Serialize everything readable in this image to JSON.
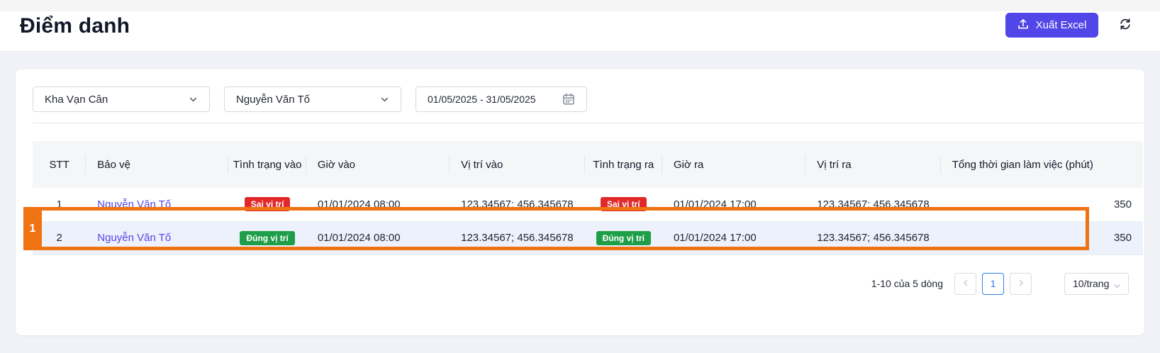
{
  "header": {
    "title": "Điểm danh",
    "export_label": "Xuất Excel",
    "export_icon": "upload-icon",
    "refresh_icon": "refresh-icon",
    "accent_color": "#5146e8"
  },
  "filters": {
    "location": "Kha Vạn Cân",
    "guard": "Nguyễn Văn Tố",
    "date_range": "01/05/2025 - 31/05/2025"
  },
  "table": {
    "columns": [
      "STT",
      "Bảo vệ",
      "Tình trạng vào",
      "Giờ vào",
      "Vị trí vào",
      "Tình trạng ra",
      "Giờ ra",
      "Vị trí ra",
      "Tổng thời gian làm việc (phút)"
    ],
    "rows": [
      {
        "stt": "1",
        "guard": "Nguyễn Văn Tố",
        "status_in": "Sai vị trí",
        "status_in_color": "#e0292b",
        "time_in": "01/01/2024 08:00",
        "loc_in": "123.34567; 456.345678",
        "status_out": "Sai vị trí",
        "status_out_color": "#e0292b",
        "time_out": "01/01/2024 17:00",
        "loc_out": "123.34567; 456.345678",
        "total": "350"
      },
      {
        "stt": "2",
        "guard": "Nguyễn Văn Tố",
        "status_in": "Đúng vị trí",
        "status_in_color": "#1e9e48",
        "time_in": "01/01/2024 08:00",
        "loc_in": "123.34567; 456.345678",
        "status_out": "Đúng vị trí",
        "status_out_color": "#1e9e48",
        "time_out": "01/01/2024 17:00",
        "loc_out": "123.34567; 456.345678",
        "total": "350"
      }
    ]
  },
  "pagination": {
    "info": "1-10 của 5 dòng",
    "current_page": "1",
    "page_size": "10/trang"
  },
  "annotation": {
    "label": "1",
    "color": "#f07313"
  }
}
